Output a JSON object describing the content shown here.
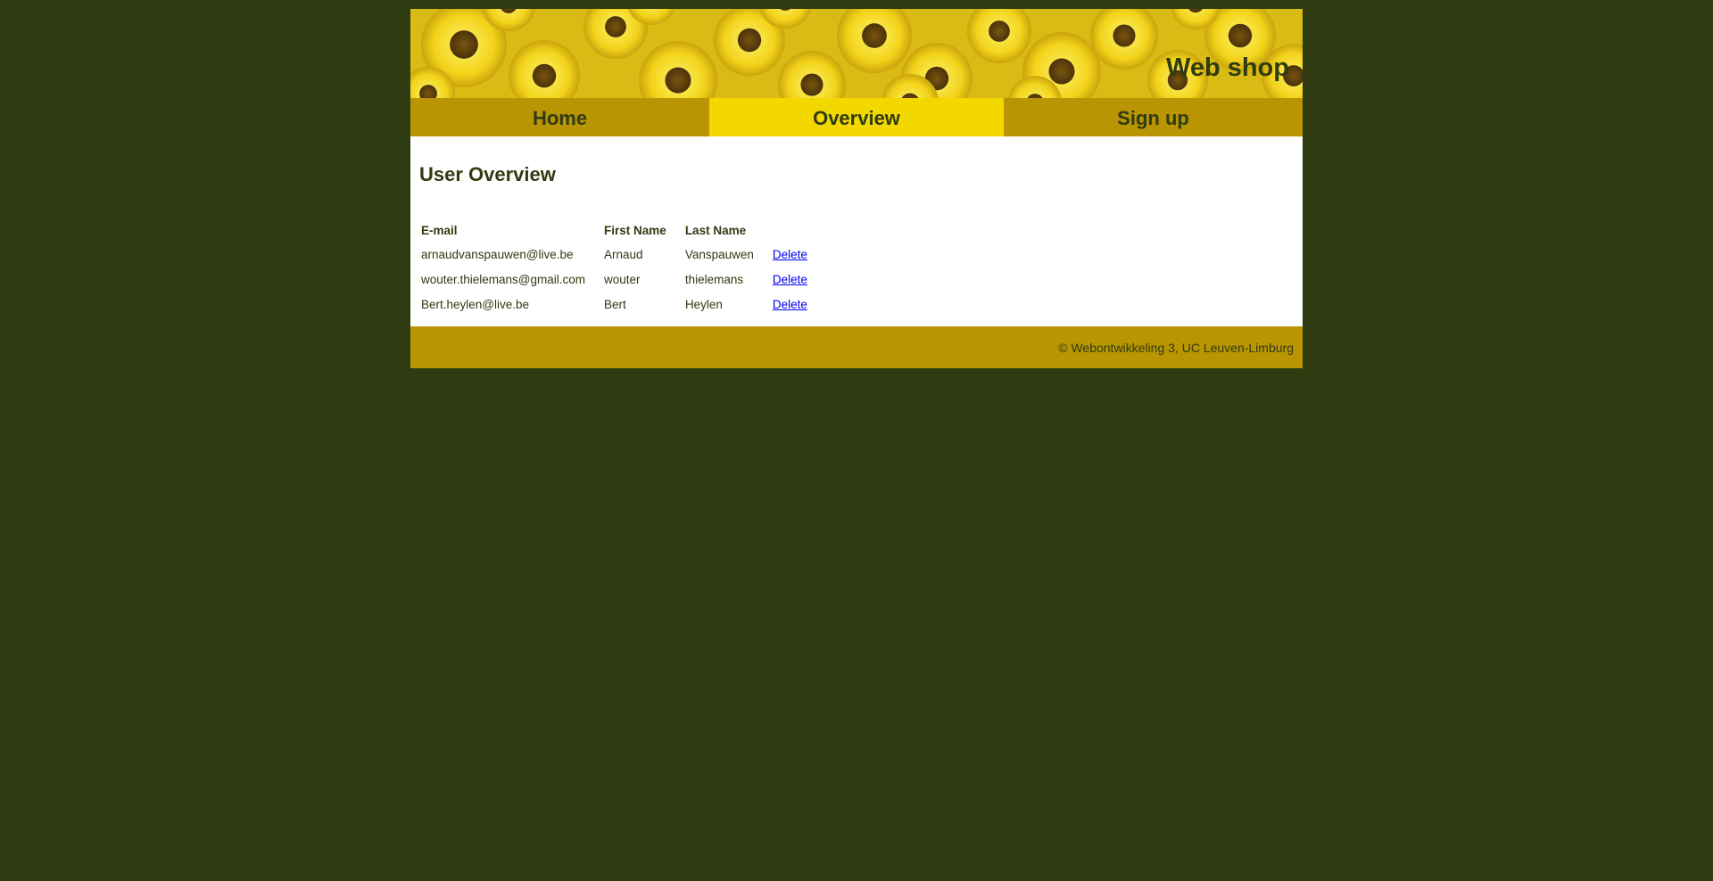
{
  "header": {
    "site_title": "Web shop"
  },
  "nav": {
    "items": [
      {
        "label": "Home",
        "active": false
      },
      {
        "label": "Overview",
        "active": true
      },
      {
        "label": "Sign up",
        "active": false
      }
    ]
  },
  "main": {
    "title": "User Overview",
    "table": {
      "columns": [
        "E-mail",
        "First Name",
        "Last Name"
      ],
      "rows": [
        {
          "email": "arnaudvanspauwen@live.be",
          "first_name": "Arnaud",
          "last_name": "Vanspauwen",
          "action": "Delete"
        },
        {
          "email": "wouter.thielemans@gmail.com",
          "first_name": "wouter",
          "last_name": "thielemans",
          "action": "Delete"
        },
        {
          "email": "Bert.heylen@live.be",
          "first_name": "Bert",
          "last_name": "Heylen",
          "action": "Delete"
        }
      ]
    }
  },
  "footer": {
    "copyright": "© Webontwikkeling 3, UC Leuven-Limburg"
  },
  "colors": {
    "page_background": "#2f3b11",
    "nav_background": "#b99503",
    "nav_active": "#f3d800",
    "text": "#2f3b11",
    "link": "#0000ee"
  }
}
